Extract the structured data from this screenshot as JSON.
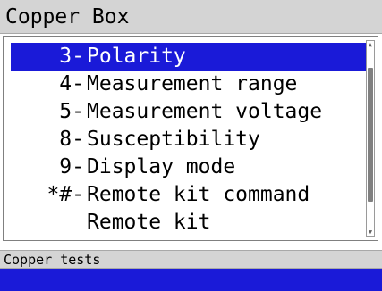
{
  "window": {
    "title": "Copper Box"
  },
  "menu": {
    "items": [
      {
        "key": "3-",
        "label": "Polarity",
        "selected": true
      },
      {
        "key": "4-",
        "label": "Measurement range",
        "selected": false
      },
      {
        "key": "5-",
        "label": "Measurement voltage",
        "selected": false
      },
      {
        "key": "8-",
        "label": "Susceptibility",
        "selected": false
      },
      {
        "key": "9-",
        "label": "Display mode",
        "selected": false
      },
      {
        "key": "*#-",
        "label": "Remote kit command",
        "selected": false
      },
      {
        "key": "",
        "label": "Remote kit",
        "selected": false
      }
    ]
  },
  "scrollbar": {
    "up_icon": "▲",
    "down_icon": "▼"
  },
  "status": {
    "text": "Copper tests"
  },
  "softkeys": [
    {
      "label": ""
    },
    {
      "label": ""
    },
    {
      "label": ""
    }
  ],
  "colors": {
    "selection": "#1a1ad8",
    "softkey_bar": "#1a1ad8",
    "titlebar": "#d4d4d4"
  }
}
